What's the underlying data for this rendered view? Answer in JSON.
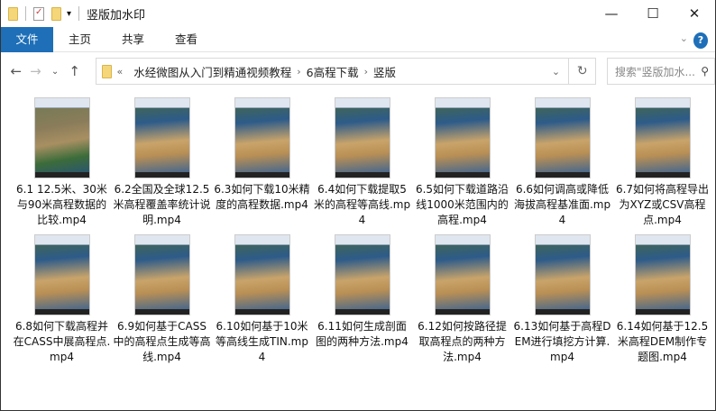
{
  "window": {
    "title": "竖版加水印",
    "minimize": "—",
    "maximize": "☐",
    "close": "✕"
  },
  "ribbon": {
    "tabs": [
      "文件",
      "主页",
      "共享",
      "查看"
    ],
    "help": "?",
    "expand": "⌄"
  },
  "nav": {
    "back": "←",
    "forward": "→",
    "recent": "⌄",
    "up": "↑",
    "breadcrumb": [
      "水经微图从入门到精通视频教程",
      "6高程下载",
      "竖版"
    ],
    "overflow": "«",
    "separator": "›",
    "dropdown": "⌄",
    "refresh": "↻",
    "search_placeholder": "搜索\"竖版加水...",
    "search_icon": "⚲"
  },
  "files": [
    {
      "name": "6.1 12.5米、30米与90米高程数据的比较.mp4",
      "thumb": "v1"
    },
    {
      "name": "6.2全国及全球12.5米高程覆盖率统计说明.mp4",
      "thumb": "v2"
    },
    {
      "name": "6.3如何下载10米精度的高程数据.mp4",
      "thumb": "v2"
    },
    {
      "name": "6.4如何下载提取5米的高程等高线.mp4",
      "thumb": "v2"
    },
    {
      "name": "6.5如何下载道路沿线1000米范围内的高程.mp4",
      "thumb": "v2"
    },
    {
      "name": "6.6如何调高或降低海拔高程基准面.mp4",
      "thumb": "v2"
    },
    {
      "name": "6.7如何将高程导出为XYZ或CSV高程点.mp4",
      "thumb": "v2"
    },
    {
      "name": "6.8如何下载高程并在CASS中展高程点.mp4",
      "thumb": "v2"
    },
    {
      "name": "6.9如何基于CASS中的高程点生成等高线.mp4",
      "thumb": "v2"
    },
    {
      "name": "6.10如何基于10米等高线生成TIN.mp4",
      "thumb": "v2"
    },
    {
      "name": "6.11如何生成剖面图的两种方法.mp4",
      "thumb": "v2"
    },
    {
      "name": "6.12如何按路径提取高程点的两种方法.mp4",
      "thumb": "v2"
    },
    {
      "name": "6.13如何基于高程DEM进行填挖方计算.mp4",
      "thumb": "v2"
    },
    {
      "name": "6.14如何基于12.5米高程DEM制作专题图.mp4",
      "thumb": "v2"
    }
  ],
  "colors": {
    "accent": "#1e6fb8",
    "folder": "#f5d77a"
  }
}
